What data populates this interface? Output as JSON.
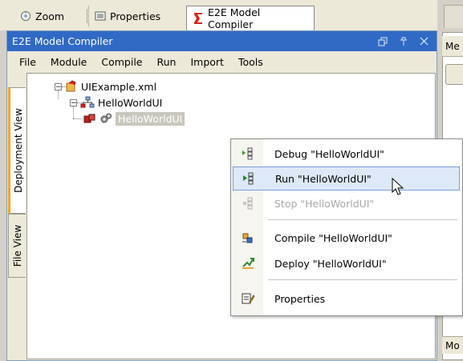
{
  "top_tabs": [
    {
      "label": "Zoom",
      "icon": "zoom-icon"
    },
    {
      "label": "Properties",
      "icon": "properties-icon"
    },
    {
      "label": "E2E Model Compiler",
      "icon": "e2e-icon"
    }
  ],
  "panel": {
    "title": "E2E Model Compiler",
    "controls": [
      "restore-icon",
      "pin-icon",
      "close-icon"
    ]
  },
  "right_panel": {
    "tab_label": "Me",
    "bottom_label": "Mo"
  },
  "menubar": [
    "File",
    "Module",
    "Compile",
    "Run",
    "Import",
    "Tools"
  ],
  "side_tabs": [
    "Deployment View",
    "File View"
  ],
  "tree": {
    "root": "UIExample.xml",
    "child": "HelloWorldUI",
    "leaf": "HelloWorldUI"
  },
  "context_menu": {
    "items": [
      {
        "label": "Debug \"HelloWorldUI\"",
        "icon": "debug-icon",
        "state": "normal"
      },
      {
        "label": "Run \"HelloWorldUI\"",
        "icon": "run-icon",
        "state": "hover"
      },
      {
        "label": "Stop \"HelloWorldUI\"",
        "icon": "stop-icon",
        "state": "disabled"
      },
      {
        "label": "Compile \"HelloWorldUI\"",
        "icon": "compile-icon",
        "state": "normal"
      },
      {
        "label": "Deploy \"HelloWorldUI\"",
        "icon": "deploy-icon",
        "state": "normal"
      },
      {
        "label": "Properties",
        "icon": "properties-icon",
        "state": "normal"
      }
    ]
  },
  "colors": {
    "titlebar": "#316ac5",
    "hover": "#dde8f8",
    "selection": "#c9c7bd",
    "side_tab_accent": "#f5a623"
  }
}
